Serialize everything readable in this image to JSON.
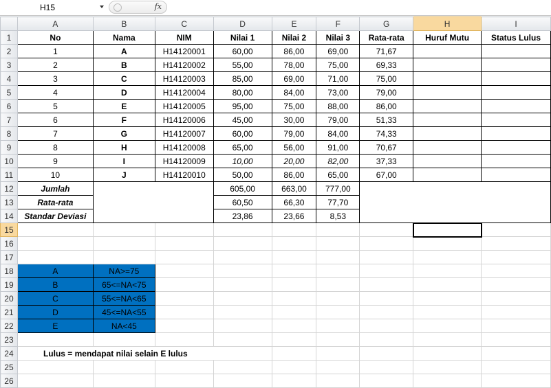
{
  "formula_bar": {
    "name_box": "H15",
    "fx_label": "fx",
    "formula": ""
  },
  "columns": [
    "A",
    "B",
    "C",
    "D",
    "E",
    "F",
    "G",
    "H",
    "I"
  ],
  "selected_column": "H",
  "selected_row": "15",
  "rows": [
    "1",
    "2",
    "3",
    "4",
    "5",
    "6",
    "7",
    "8",
    "9",
    "10",
    "11",
    "12",
    "13",
    "14",
    "15",
    "16",
    "17",
    "18",
    "19",
    "20",
    "21",
    "22",
    "23",
    "24",
    "25",
    "26"
  ],
  "table_header": [
    "No",
    "Nama",
    "NIM",
    "Nilai 1",
    "Nilai 2",
    "Nilai 3",
    "Rata-rata",
    "Huruf Mutu",
    "Status Lulus"
  ],
  "students": [
    {
      "no": "1",
      "nama": "A",
      "nim": "H14120001",
      "n1": "60,00",
      "n2": "86,00",
      "n3": "69,00",
      "avg": "71,67"
    },
    {
      "no": "2",
      "nama": "B",
      "nim": "H14120002",
      "n1": "55,00",
      "n2": "78,00",
      "n3": "75,00",
      "avg": "69,33"
    },
    {
      "no": "3",
      "nama": "C",
      "nim": "H14120003",
      "n1": "85,00",
      "n2": "69,00",
      "n3": "71,00",
      "avg": "75,00"
    },
    {
      "no": "4",
      "nama": "D",
      "nim": "H14120004",
      "n1": "80,00",
      "n2": "84,00",
      "n3": "73,00",
      "avg": "79,00"
    },
    {
      "no": "5",
      "nama": "E",
      "nim": "H14120005",
      "n1": "95,00",
      "n2": "75,00",
      "n3": "88,00",
      "avg": "86,00"
    },
    {
      "no": "6",
      "nama": "F",
      "nim": "H14120006",
      "n1": "45,00",
      "n2": "30,00",
      "n3": "79,00",
      "avg": "51,33"
    },
    {
      "no": "7",
      "nama": "G",
      "nim": "H14120007",
      "n1": "60,00",
      "n2": "79,00",
      "n3": "84,00",
      "avg": "74,33"
    },
    {
      "no": "8",
      "nama": "H",
      "nim": "H14120008",
      "n1": "65,00",
      "n2": "56,00",
      "n3": "91,00",
      "avg": "70,67"
    },
    {
      "no": "9",
      "nama": "I",
      "nim": "H14120009",
      "n1": "10,00",
      "n2": "20,00",
      "n3": "82,00",
      "avg": "37,33"
    },
    {
      "no": "10",
      "nama": "J",
      "nim": "H14120010",
      "n1": "50,00",
      "n2": "86,00",
      "n3": "65,00",
      "avg": "67,00"
    }
  ],
  "stats": [
    {
      "label": "Jumlah",
      "n1": "605,00",
      "n2": "663,00",
      "n3": "777,00"
    },
    {
      "label": "Rata-rata",
      "n1": "60,50",
      "n2": "66,30",
      "n3": "77,70"
    },
    {
      "label": "Standar Deviasi",
      "n1": "23,86",
      "n2": "23,66",
      "n3": "8,53"
    }
  ],
  "grades": [
    {
      "grade": "A",
      "rule": "NA>=75"
    },
    {
      "grade": "B",
      "rule": "65<=NA<75"
    },
    {
      "grade": "C",
      "rule": "55<=NA<65"
    },
    {
      "grade": "D",
      "rule": "45<=NA<55"
    },
    {
      "grade": "E",
      "rule": "NA<45"
    }
  ],
  "note": "Lulus = mendapat nilai selain E lulus",
  "colors": {
    "grade_fill": "#0070c0",
    "selection_header": "#f9d99f"
  }
}
